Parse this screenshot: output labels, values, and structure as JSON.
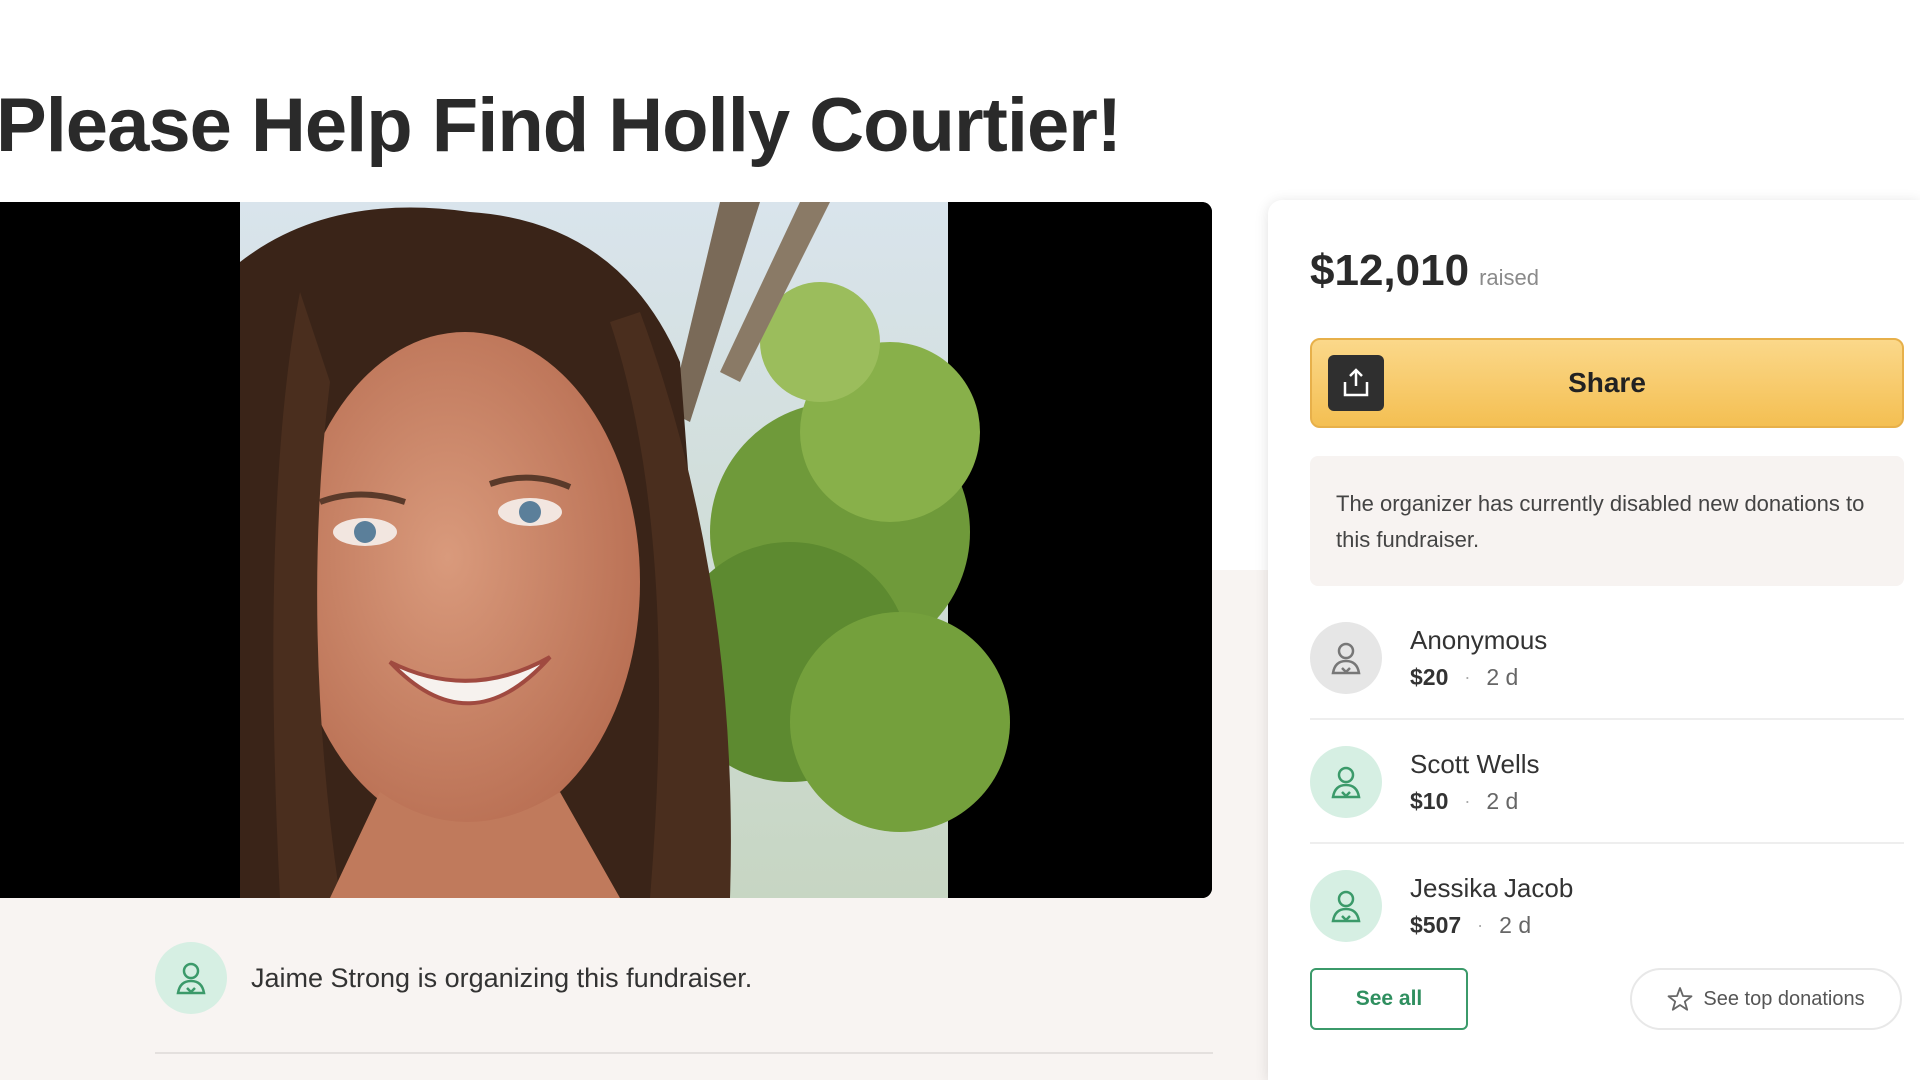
{
  "campaign": {
    "title": "Please Help Find Holly Courtier!"
  },
  "organizer": {
    "text": "Jaime Strong is organizing this fundraiser.",
    "avatar_icon": "person-heart-icon"
  },
  "sidebar": {
    "raised_amount": "$12,010",
    "raised_label": "raised",
    "share": {
      "label": "Share",
      "icon": "share-upload-icon"
    },
    "notice": "The organizer has currently disabled new donations to this fundraiser.",
    "donations": [
      {
        "name": "Anonymous",
        "amount": "$20",
        "time": "2 d",
        "avatar": "anonymous"
      },
      {
        "name": "Scott Wells",
        "amount": "$10",
        "time": "2 d",
        "avatar": "donor"
      },
      {
        "name": "Jessika Jacob",
        "amount": "$507",
        "time": "2 d",
        "avatar": "donor"
      }
    ],
    "separator": "·",
    "see_all_label": "See all",
    "top_donations_label": "See top donations",
    "top_donations_icon": "star-outline-icon"
  },
  "colors": {
    "share_button": "#f4bf52",
    "brand_green": "#2f8f5f",
    "avatar_green_bg": "#d6efe3"
  }
}
